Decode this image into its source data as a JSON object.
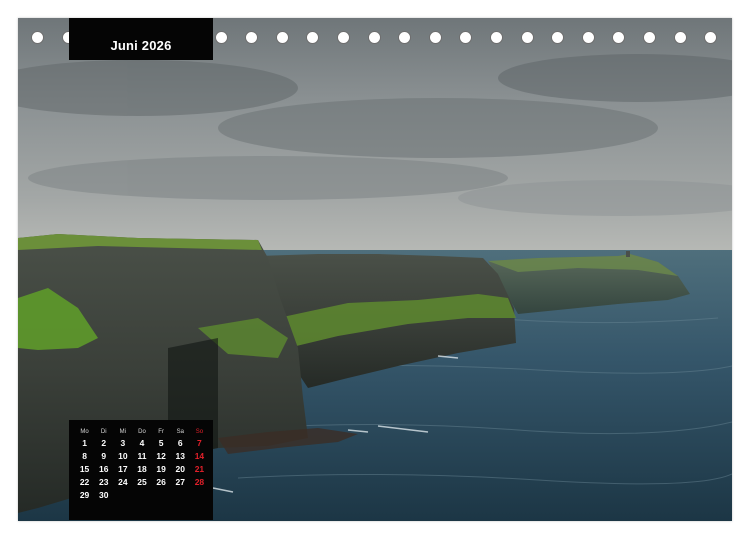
{
  "calendar": {
    "month_title": "Juni 2026",
    "weekdays": [
      "Mo",
      "Di",
      "Mi",
      "Do",
      "Fr",
      "Sa",
      "So"
    ],
    "weeks": [
      [
        "1",
        "2",
        "3",
        "4",
        "5",
        "6",
        "7"
      ],
      [
        "8",
        "9",
        "10",
        "11",
        "12",
        "13",
        "14"
      ],
      [
        "15",
        "16",
        "17",
        "18",
        "19",
        "20",
        "21"
      ],
      [
        "22",
        "23",
        "24",
        "25",
        "26",
        "27",
        "28"
      ],
      [
        "29",
        "30",
        "",
        "",
        "",
        "",
        ""
      ]
    ]
  },
  "colors": {
    "panel_background": "#050505",
    "text": "#ffffff",
    "sunday": "#e2202a",
    "sea": "#2f4f5c",
    "cliff_green": "#5f8a2e",
    "sky": "#8a9092"
  },
  "photo": {
    "subject": "sea cliffs with green tops above a dark sea under an overcast sky"
  },
  "binding": {
    "hole_count": 23
  }
}
